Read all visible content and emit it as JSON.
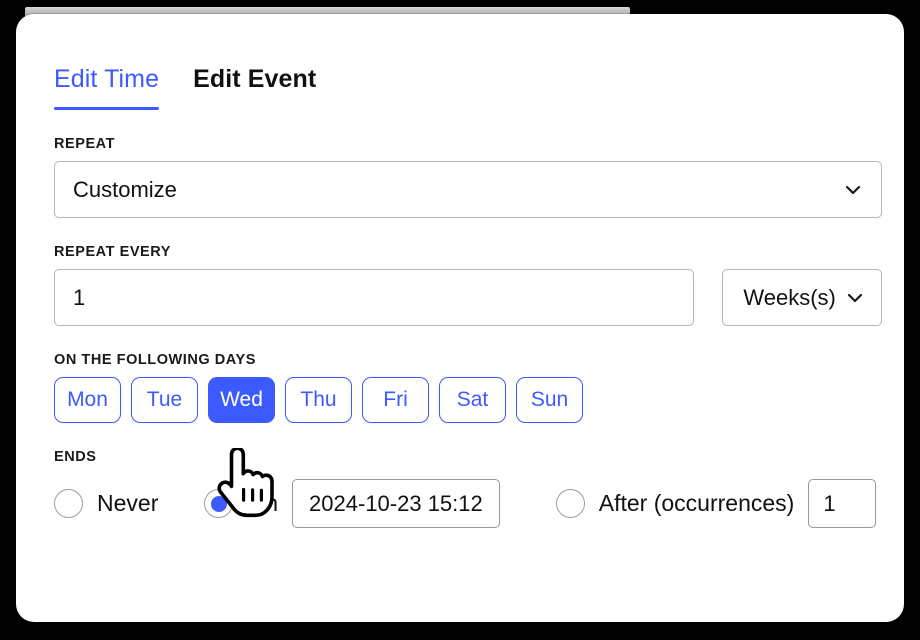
{
  "window": {
    "background_color": "#000000",
    "card_color": "#ffffff",
    "accent_color": "#3d5afe"
  },
  "tabs": [
    {
      "label": "Edit Time",
      "active": true
    },
    {
      "label": "Edit Event",
      "active": false
    }
  ],
  "repeat": {
    "label": "REPEAT",
    "value": "Customize",
    "chevron_icon": "chevron-down-icon"
  },
  "repeat_every": {
    "label": "REPEAT EVERY",
    "value": "1",
    "unit_value": "Weeks(s)",
    "chevron_icon": "chevron-down-icon"
  },
  "days": {
    "label": "ON THE FOLLOWING DAYS",
    "items": [
      {
        "label": "Mon",
        "selected": false
      },
      {
        "label": "Tue",
        "selected": false
      },
      {
        "label": "Wed",
        "selected": true
      },
      {
        "label": "Thu",
        "selected": false
      },
      {
        "label": "Fri",
        "selected": false
      },
      {
        "label": "Sat",
        "selected": false
      },
      {
        "label": "Sun",
        "selected": false
      }
    ]
  },
  "ends": {
    "label": "ENDS",
    "never": {
      "label": "Never",
      "selected": false
    },
    "on": {
      "label": "On",
      "selected": true,
      "date_value": "2024-10-23 15:12"
    },
    "after": {
      "label": "After (occurrences)",
      "selected": false,
      "count_value": "1"
    }
  },
  "cursor": {
    "icon": "pointing-hand-cursor"
  }
}
